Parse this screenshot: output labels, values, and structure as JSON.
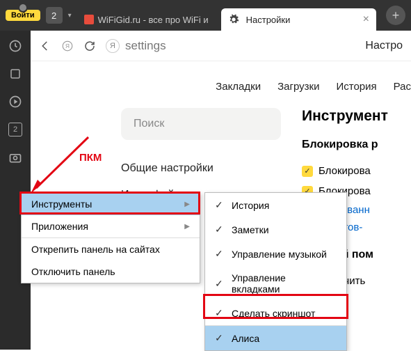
{
  "titlebar": {
    "login": "Войти",
    "tab_count": "2",
    "inactive_tab": "WiFiGid.ru - все про WiFi и",
    "active_tab": "Настройки"
  },
  "toolbar": {
    "omnibox": "settings",
    "right_label": "Настро"
  },
  "nav": [
    "Закладки",
    "Загрузки",
    "История",
    "Рас"
  ],
  "left_col": {
    "search_placeholder": "Поиск",
    "items": [
      "Общие настройки",
      "Интерфейс"
    ]
  },
  "right_col": {
    "title": "Инструмент",
    "block_title": "Блокировка р",
    "checks": [
      "Блокирова",
      "Блокирова"
    ],
    "links": [
      "аблокированн",
      "исок сайтов-"
    ],
    "voice_title": "лосовой пом",
    "voice_check": "Включить"
  },
  "ctx1": {
    "items": [
      {
        "label": "Инструменты",
        "arrow": true,
        "hl": true
      },
      {
        "label": "Приложения",
        "arrow": true
      }
    ],
    "items2": [
      "Открепить панель на сайтах",
      "Отключить панель"
    ]
  },
  "ctx2": {
    "items": [
      {
        "label": "История",
        "chk": true
      },
      {
        "label": "Заметки",
        "chk": true
      },
      {
        "label": "Управление музыкой",
        "chk": true
      },
      {
        "label": "Управление вкладками",
        "chk": true
      },
      {
        "label": "Сделать скриншот",
        "chk": true
      },
      {
        "label": "Алиса",
        "chk": true,
        "hl": true
      }
    ]
  },
  "annotation": {
    "rmb": "ПКМ"
  },
  "sidebar": {
    "box_value": "2"
  }
}
